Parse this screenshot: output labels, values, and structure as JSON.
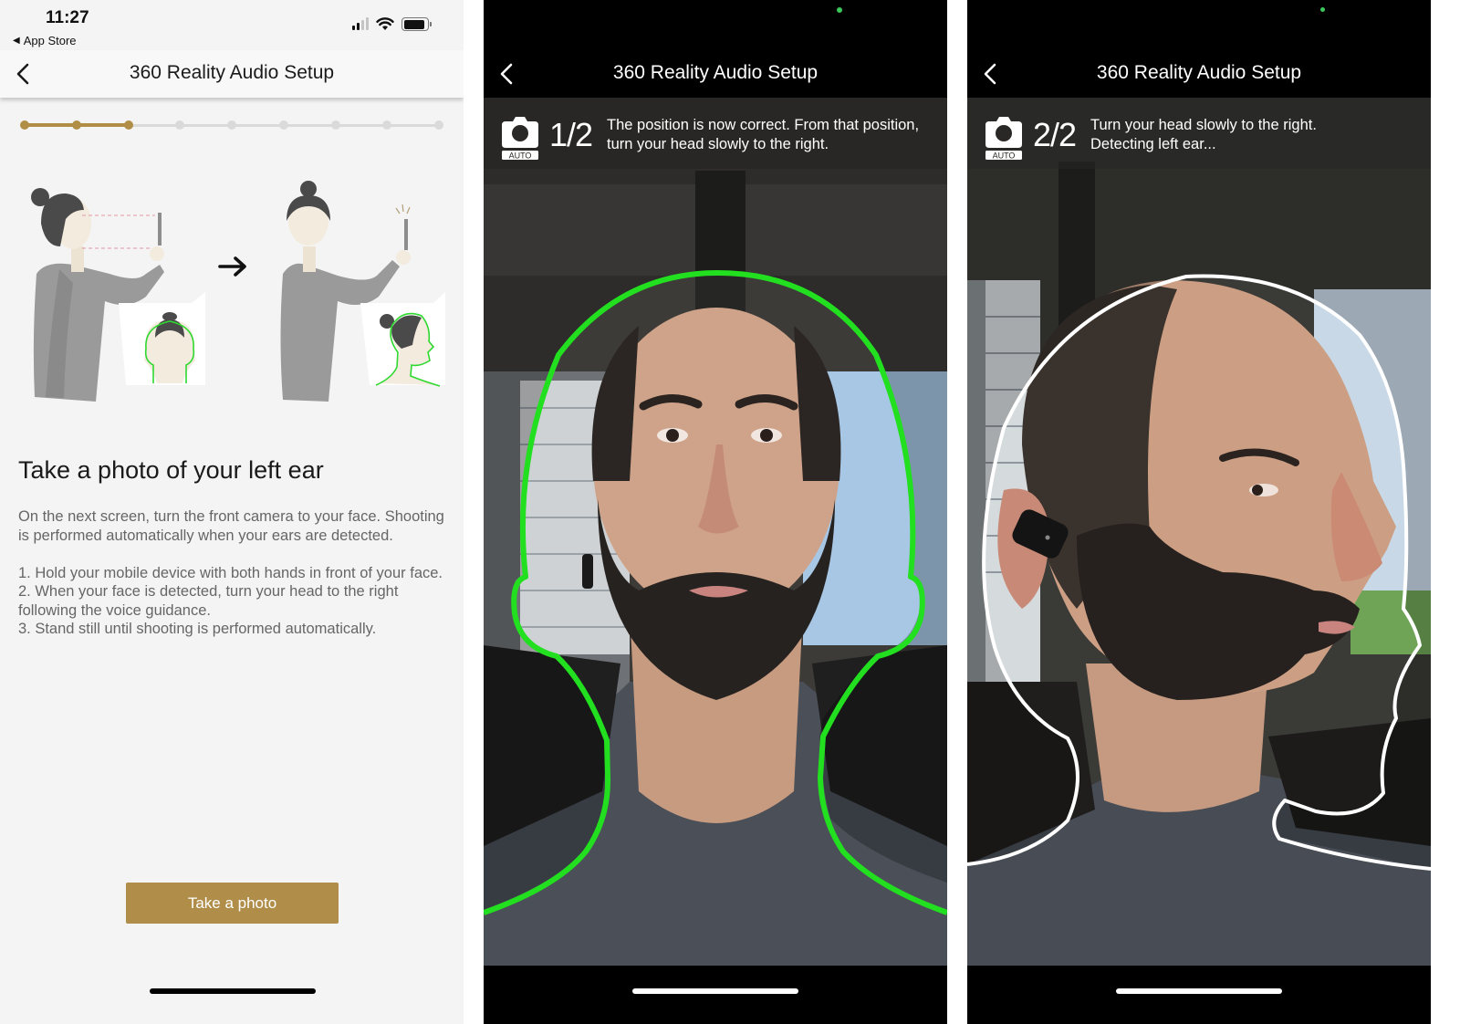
{
  "colors": {
    "accent_gold": "#b08e45",
    "button_gold": "#b08e4a",
    "progress_inactive": "#dadada",
    "face_outline_green": "#22e01f",
    "face_outline_white": "#ffffff"
  },
  "screen1": {
    "status_bar": {
      "time": "11:27",
      "back_app_label": "App Store",
      "signal_bars_active": 2,
      "signal_bars_total": 4,
      "battery_level": 0.9
    },
    "nav": {
      "back_icon": "chevron-left-icon",
      "title": "360 Reality Audio Setup"
    },
    "progress": {
      "total_steps": 9,
      "current_step": 3
    },
    "illustration": {
      "description": "Woman holding phone in front of face, arrow, woman turning head to the right",
      "arrow_icon": "arrow-right-icon"
    },
    "heading": "Take a photo of your left ear",
    "intro": "On the next screen, turn the front camera to your face. Shooting is performed automatically when your ears are detected.",
    "steps": [
      "1. Hold your mobile device with both hands in front of your face.",
      "2. When your face is detected, turn your head to the right following the voice guidance.",
      "3. Stand still until shooting is performed automatically."
    ],
    "button_label": "Take a photo"
  },
  "screen2": {
    "nav": {
      "back_icon": "chevron-left-icon",
      "title": "360 Reality Audio Setup"
    },
    "camera_badge": "AUTO",
    "step_count": "1/2",
    "message": "The position is now correct. From that position, turn your head slowly to the right.",
    "outline": "front-face-outline",
    "outline_color": "#22e01f"
  },
  "screen3": {
    "nav": {
      "back_icon": "chevron-left-icon",
      "title": "360 Reality Audio Setup"
    },
    "camera_badge": "AUTO",
    "step_count": "2/2",
    "message": "Turn your head slowly to the right. Detecting left ear...",
    "outline": "side-profile-outline",
    "outline_color": "#ffffff"
  }
}
